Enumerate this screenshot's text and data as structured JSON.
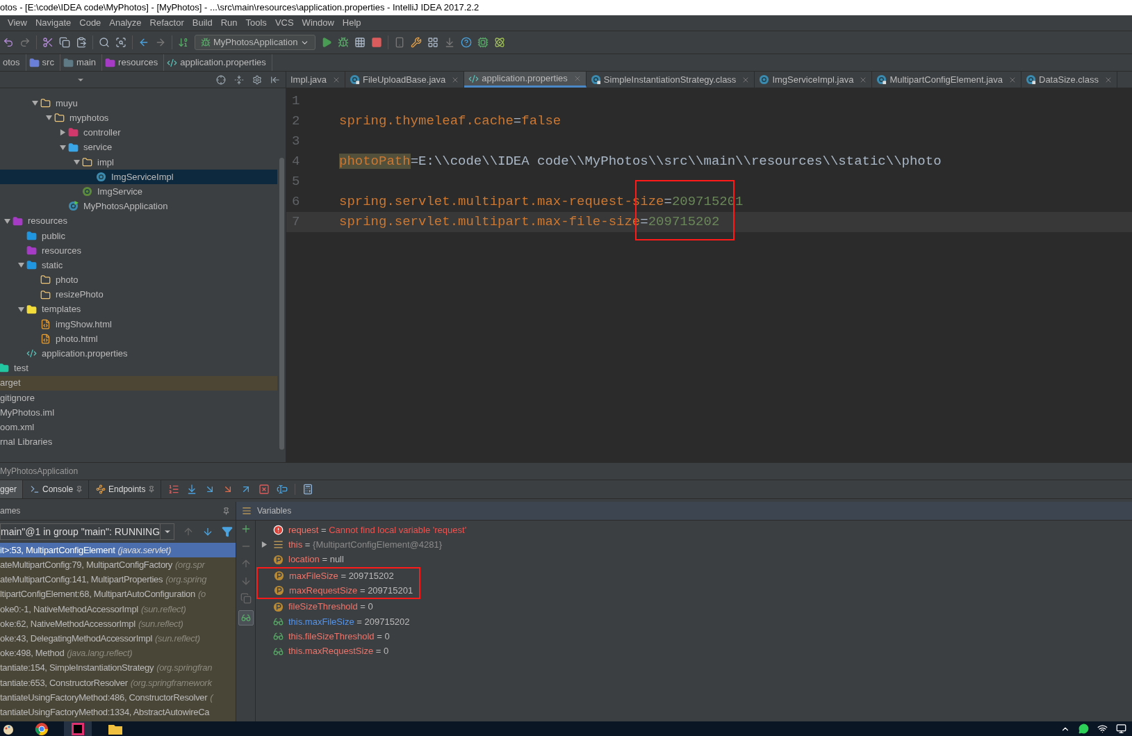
{
  "window": {
    "title": "otos - [E:\\code\\IDEA code\\MyPhotos] - [MyPhotos] - ...\\src\\main\\resources\\application.properties - IntelliJ IDEA 2017.2.2"
  },
  "menu": [
    "View",
    "Navigate",
    "Code",
    "Analyze",
    "Refactor",
    "Build",
    "Run",
    "Tools",
    "VCS",
    "Window",
    "Help"
  ],
  "toolbar": {
    "run_config": "MyPhotosApplication"
  },
  "breadcrumbs": [
    {
      "label": "otos"
    },
    {
      "label": "src",
      "kind": "source"
    },
    {
      "label": "main",
      "kind": "folder"
    },
    {
      "label": "resources",
      "kind": "resources"
    },
    {
      "label": "application.properties",
      "kind": "properties"
    }
  ],
  "project_tree": [
    {
      "children": [
        {
          "children": [
            {
              "children": [
                {
                  "children": [
                    {
                      "label": "muyu",
                      "kind": "package",
                      "expanded": true,
                      "selected": false,
                      "children": [
                        {
                          "label": "myphotos",
                          "kind": "package",
                          "expanded": true,
                          "selected": false,
                          "children": [
                            {
                              "label": "controller",
                              "kind": "controller",
                              "expanded": false,
                              "selected": false
                            },
                            {
                              "label": "service",
                              "kind": "service",
                              "expanded": true,
                              "selected": false,
                              "children": [
                                {
                                  "label": "impl",
                                  "kind": "package",
                                  "expanded": true,
                                  "selected": false,
                                  "children": [
                                    {
                                      "label": "ImgServiceImpl",
                                      "kind": "class",
                                      "selected": true
                                    }
                                  ]
                                },
                                {
                                  "label": "ImgService",
                                  "kind": "interface",
                                  "selected": false
                                }
                              ]
                            },
                            {
                              "label": "MyPhotosApplication",
                              "kind": "spring-app",
                              "selected": false
                            }
                          ]
                        }
                      ]
                    }
                  ]
                }
              ]
            },
            {
              "label": "resources",
              "kind": "resources",
              "expanded": true,
              "selected": false,
              "children": [
                {
                  "label": "public",
                  "kind": "web",
                  "selected": false
                },
                {
                  "label": "resources",
                  "kind": "resources",
                  "selected": false
                },
                {
                  "label": "static",
                  "kind": "web",
                  "expanded": true,
                  "selected": false,
                  "children": [
                    {
                      "label": "photo",
                      "kind": "package",
                      "selected": false
                    },
                    {
                      "label": "resizePhoto",
                      "kind": "package",
                      "selected": false
                    }
                  ]
                },
                {
                  "label": "templates",
                  "kind": "templates",
                  "expanded": true,
                  "selected": false,
                  "children": [
                    {
                      "label": "imgShow.html",
                      "kind": "html",
                      "selected": false
                    },
                    {
                      "label": "photo.html",
                      "kind": "html",
                      "selected": false
                    }
                  ]
                },
                {
                  "label": "application.properties",
                  "kind": "properties",
                  "selected": false
                }
              ]
            }
          ]
        },
        {
          "label": "test",
          "kind": "test",
          "selected": false
        }
      ]
    },
    {
      "label": "arget",
      "selected": false,
      "excluded": true
    },
    {
      "label": "gitignore",
      "selected": false,
      "excluded": false
    },
    {
      "label": "MyPhotos.iml",
      "selected": false,
      "excluded": false
    },
    {
      "label": "oom.xml",
      "selected": false,
      "excluded": false
    },
    {
      "label": "rnal Libraries",
      "selected": false,
      "excluded": false
    }
  ],
  "editor": {
    "tabs": [
      {
        "label": "Impl.java",
        "selected": false
      },
      {
        "label": "FileUploadBase.java",
        "kind": "class-locked",
        "selected": false
      },
      {
        "label": "application.properties",
        "kind": "properties",
        "selected": true
      },
      {
        "label": "SimpleInstantiationStrategy.class",
        "kind": "class-locked",
        "selected": false
      },
      {
        "label": "ImgServiceImpl.java",
        "kind": "class",
        "selected": false
      },
      {
        "label": "MultipartConfigElement.java",
        "kind": "class-locked",
        "selected": false
      },
      {
        "label": "DataSize.class",
        "kind": "class-locked",
        "selected": false
      }
    ],
    "annotation": true,
    "lines": [
      {
        "number": "1",
        "current": false
      },
      {
        "number": "2",
        "key": "spring.thymeleaf.cache",
        "separator": "=",
        "value": "false",
        "kind": "boolean",
        "current": false
      },
      {
        "number": "3",
        "current": false
      },
      {
        "number": "4",
        "key": "photoPath",
        "key_highlighted": true,
        "separator": "=",
        "value": "E:\\\\code\\\\IDEA code\\\\MyPhotos\\\\src\\\\main\\\\resources\\\\static\\\\photo",
        "kind": "text",
        "current": false
      },
      {
        "number": "5",
        "current": false
      },
      {
        "number": "6",
        "key": "spring.servlet.multipart.max-request-size",
        "separator": "=",
        "value": "209715201",
        "kind": "number",
        "current": false
      },
      {
        "number": "7",
        "key": "spring.servlet.multipart.max-file-size",
        "separator": "=",
        "value": "209715202",
        "kind": "number",
        "current": true
      }
    ]
  },
  "debug": {
    "title": "MyPhotosApplication",
    "tabs": [
      {
        "label": "gger",
        "kind": "debugger",
        "selected": true
      },
      {
        "label": "Console",
        "kind": "console",
        "selected": false
      },
      {
        "label": "Endpoints",
        "kind": "endpoints",
        "selected": false
      }
    ],
    "frames_header": "ames",
    "variables_header": "Variables",
    "thread": "main\"@1 in group \"main\": RUNNING",
    "frames": [
      {
        "method": "it>:53, MultipartConfigElement",
        "package": "(javax.servlet)",
        "selected": true
      },
      {
        "method": "ateMultipartConfig:79, MultipartConfigFactory",
        "package": "(org.spr",
        "selected": false
      },
      {
        "method": "ateMultipartConfig:141, MultipartProperties",
        "package": "(org.spring",
        "selected": false
      },
      {
        "method": "ltipartConfigElement:68, MultipartAutoConfiguration",
        "package": "(o",
        "selected": false
      },
      {
        "method": "oke0:-1, NativeMethodAccessorImpl",
        "package": "(sun.reflect)",
        "selected": false
      },
      {
        "method": "oke:62, NativeMethodAccessorImpl",
        "package": "(sun.reflect)",
        "selected": false
      },
      {
        "method": "oke:43, DelegatingMethodAccessorImpl",
        "package": "(sun.reflect)",
        "selected": false
      },
      {
        "method": "oke:498, Method",
        "package": "(java.lang.reflect)",
        "selected": false
      },
      {
        "method": "tantiate:154, SimpleInstantiationStrategy",
        "package": "(org.springfran",
        "selected": false
      },
      {
        "method": "tantiate:653, ConstructorResolver",
        "package": "(org.springframework",
        "selected": false
      },
      {
        "method": "tantiateUsingFactoryMethod:486, ConstructorResolver",
        "package": "(",
        "selected": false
      },
      {
        "method": "tantiateUsingFactoryMethod:1334, AbstractAutowireCa",
        "selected": false
      }
    ],
    "variables": [
      {
        "kind": "error",
        "name": "request",
        "separator": "=",
        "value": "Cannot find local variable 'request'",
        "boxed": false
      },
      {
        "kind": "object",
        "name": "this",
        "separator": "=",
        "value": "{MultipartConfigElement@4281}",
        "expanded": false,
        "boxed": false
      },
      {
        "kind": "field",
        "name": "location",
        "separator": "=",
        "value": "null",
        "boxed": false
      },
      {
        "kind": "field",
        "name": "maxFileSize",
        "separator": "=",
        "value": "209715202",
        "boxed": true
      },
      {
        "kind": "field",
        "name": "maxRequestSize",
        "separator": "=",
        "value": "209715201",
        "boxed": true
      },
      {
        "kind": "field",
        "name": "fileSizeThreshold",
        "separator": "=",
        "value": "0",
        "boxed": false
      },
      {
        "kind": "watch",
        "name": "this.maxFileSize",
        "separator": "=",
        "value": "209715202",
        "changed": true,
        "boxed": false
      },
      {
        "kind": "watch",
        "name": "this.fileSizeThreshold",
        "separator": "=",
        "value": "0",
        "changed": false,
        "boxed": false
      },
      {
        "kind": "watch",
        "name": "this.maxRequestSize",
        "separator": "=",
        "value": "0",
        "changed": false,
        "boxed": false
      }
    ]
  }
}
